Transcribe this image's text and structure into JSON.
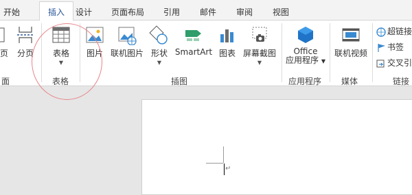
{
  "tabs": [
    "开始",
    "插入",
    "设计",
    "页面布局",
    "引用",
    "邮件",
    "审阅",
    "视图"
  ],
  "ribbon": {
    "partial_left_label": "页",
    "page_break": "分页",
    "table": "表格",
    "picture": "图片",
    "online_picture": "联机图片",
    "shapes": "形状",
    "smartart": "SmartArt",
    "chart": "图表",
    "screenshot": "屏幕截图",
    "office_line1": "Office",
    "office_line2": "应用程序",
    "online_video": "联机视频",
    "hyperlink": "超链接",
    "bookmark": "书签",
    "cross_ref": "交叉引"
  },
  "groups": {
    "left_partial": "面",
    "tables": "表格",
    "illustrations": "插图",
    "apps": "应用程序",
    "media": "媒体",
    "links": "链接"
  },
  "document": {
    "paragraph_mark": "↵"
  },
  "colors": {
    "accent": "#2b579a",
    "annotation": "#e8848a"
  }
}
